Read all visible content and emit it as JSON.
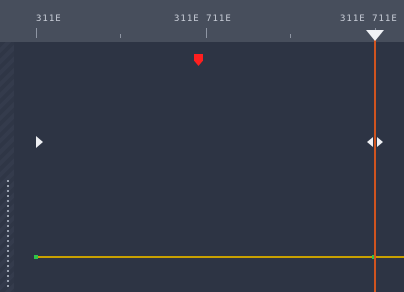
{
  "ruler": {
    "labels": [
      "311E",
      "311E 711E",
      "311E 711E"
    ]
  },
  "colors": {
    "background": "#2a3040",
    "ruler": "#474e5c",
    "playhead": "#d0541f",
    "marker": "#ff1f1f",
    "keyline": "#c8a000",
    "keyframe": "#2ec44a"
  },
  "icons": {
    "marker": "red-marker-icon",
    "left_keyframe": "triangle-right-icon",
    "right_keyframe": "double-arrow-icon",
    "playhead": "playhead-triangle-icon"
  }
}
